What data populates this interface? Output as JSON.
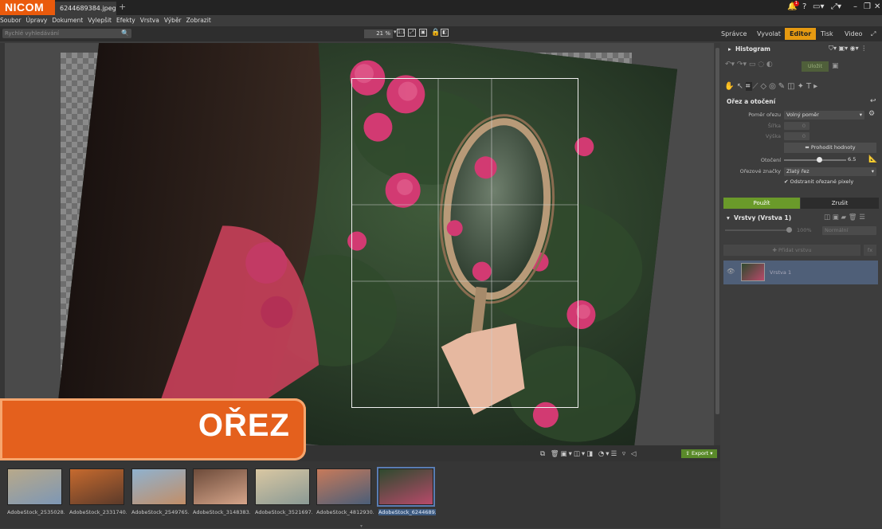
{
  "app": {
    "brand": "NICOM",
    "file_tab": "6244689384.jpeg",
    "new_tab": "+"
  },
  "title_icons": {
    "bell_badge": "1",
    "help": "?"
  },
  "menu": [
    "Soubor",
    "Úpravy",
    "Dokument",
    "Vylepšit",
    "Efekty",
    "Vrstva",
    "Výběr",
    "Zobrazit"
  ],
  "search": {
    "placeholder": "Rychlé vyhledávání"
  },
  "zoom": {
    "value": "21 %"
  },
  "modes": {
    "sprava": "Správce",
    "vyvolat": "Vyvolat",
    "editor": "Editor",
    "tisk": "Tisk",
    "video": "Video"
  },
  "panel": {
    "histogram_title": "Histogram",
    "crop_title": "Ořez a otočení",
    "ratio_label": "Poměr ořezu",
    "ratio_value": "Volný poměr",
    "width_label": "Šířka",
    "width_value": "0",
    "height_label": "Výška",
    "height_value": "0",
    "swap_button": "Prohodit hodnoty",
    "rotate_label": "Otočení",
    "rotate_value": "6.5",
    "rotate_fraction": 0.56,
    "guides_label": "Ořezové značky",
    "guides_value": "Zlatý řez",
    "delete_pixels": "Odstranit ořezané pixely",
    "apply": "Použít",
    "cancel": "Zrušit",
    "layers_title": "Vrstvy (Vrstva 1)",
    "opacity": "100%",
    "blend": "Normální",
    "add_layer": "Přidat vrstvu",
    "fx": "fx",
    "layer_name": "Vrstva 1",
    "undo": "Uložit"
  },
  "film": {
    "export": "Export",
    "thumbs": [
      {
        "caption": "AdobeStock_2535028...",
        "c1": "#b8a98a",
        "c2": "#7d97b5"
      },
      {
        "caption": "AdobeStock_2331740...",
        "c1": "#c66a2e",
        "c2": "#5b3a2a"
      },
      {
        "caption": "AdobeStock_2549765...",
        "c1": "#8fb2cf",
        "c2": "#c28e67"
      },
      {
        "caption": "AdobeStock_3148383...",
        "c1": "#6d4b3a",
        "c2": "#d6a58a"
      },
      {
        "caption": "AdobeStock_3521697...",
        "c1": "#d9c7a2",
        "c2": "#8a9a95"
      },
      {
        "caption": "AdobeStock_4812930...",
        "c1": "#c77a5a",
        "c2": "#4a5e78"
      },
      {
        "caption": "AdobeStock_6244689...",
        "c1": "#2e4a2e",
        "c2": "#b84a6a"
      }
    ]
  },
  "overlay": {
    "text": "OŘEZ"
  },
  "colors": {
    "accent": "#e69a11",
    "brand": "#ea5a0c",
    "apply_green": "#6a9a2a",
    "overlay": "#e4601d"
  }
}
